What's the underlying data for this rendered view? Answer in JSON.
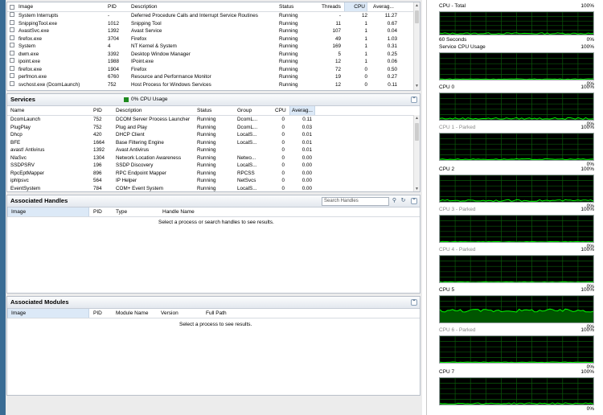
{
  "processes": {
    "columns": [
      "Image",
      "PID",
      "Description",
      "Status",
      "Threads",
      "CPU",
      "Averag..."
    ],
    "rows": [
      [
        "System Interrupts",
        "-",
        "Deferred Procedure Calls and Interrupt Service Routines",
        "Running",
        "-",
        "12",
        "11.27"
      ],
      [
        "SnippingTool.exe",
        "1012",
        "Snipping Tool",
        "Running",
        "11",
        "1",
        "0.67"
      ],
      [
        "AvastSvc.exe",
        "1392",
        "Avast Service",
        "Running",
        "107",
        "1",
        "0.04"
      ],
      [
        "firefox.exe",
        "3704",
        "Firefox",
        "Running",
        "49",
        "1",
        "1.03"
      ],
      [
        "System",
        "4",
        "NT Kernel & System",
        "Running",
        "169",
        "1",
        "0.31"
      ],
      [
        "dwm.exe",
        "3392",
        "Desktop Window Manager",
        "Running",
        "5",
        "1",
        "0.25"
      ],
      [
        "ipoint.exe",
        "1988",
        "IPoint.exe",
        "Running",
        "12",
        "1",
        "0.06"
      ],
      [
        "firefox.exe",
        "1904",
        "Firefox",
        "Running",
        "72",
        "0",
        "0.50"
      ],
      [
        "perfmon.exe",
        "6760",
        "Resource and Performance Monitor",
        "Running",
        "19",
        "0",
        "0.27"
      ],
      [
        "svchost.exe (DcomLaunch)",
        "752",
        "Host Process for Windows Services",
        "Running",
        "12",
        "0",
        "0.11"
      ]
    ]
  },
  "services": {
    "title": "Services",
    "badge": "0% CPU Usage",
    "columns": [
      "Name",
      "PID",
      "Description",
      "Status",
      "Group",
      "CPU",
      "Averag..."
    ],
    "rows": [
      [
        "DcomLaunch",
        "752",
        "DCOM Server Process Launcher",
        "Running",
        "DcomL...",
        "0",
        "0.11"
      ],
      [
        "PlugPlay",
        "752",
        "Plug and Play",
        "Running",
        "DcomL...",
        "0",
        "0.03"
      ],
      [
        "Dhcp",
        "420",
        "DHCP Client",
        "Running",
        "LocalS...",
        "0",
        "0.01"
      ],
      [
        "BFE",
        "1664",
        "Base Filtering Engine",
        "Running",
        "LocalS...",
        "0",
        "0.01"
      ],
      [
        "avast! Antivirus",
        "1392",
        "Avast Antivirus",
        "Running",
        "",
        "0",
        "0.01"
      ],
      [
        "NlaSvc",
        "1304",
        "Network Location Awareness",
        "Running",
        "Netwo...",
        "0",
        "0.00"
      ],
      [
        "SSDPSRV",
        "196",
        "SSDP Discovery",
        "Running",
        "LocalS...",
        "0",
        "0.00"
      ],
      [
        "RpcEptMapper",
        "896",
        "RPC Endpoint Mapper",
        "Running",
        "RPCSS",
        "0",
        "0.00"
      ],
      [
        "iphlpsvc",
        "564",
        "IP Helper",
        "Running",
        "NetSvcs",
        "0",
        "0.00"
      ],
      [
        "EventSystem",
        "784",
        "COM+ Event System",
        "Running",
        "LocalS...",
        "0",
        "0.00"
      ]
    ]
  },
  "handles": {
    "title": "Associated Handles",
    "search_placeholder": "Search Handles",
    "columns": [
      "Image",
      "PID",
      "Type",
      "Handle Name"
    ],
    "empty_message": "Select a process or search handles to see results."
  },
  "modules": {
    "title": "Associated Modules",
    "columns": [
      "Image",
      "PID",
      "Module Name",
      "Version",
      "Full Path"
    ],
    "empty_message": "Select a process to see results."
  },
  "graphs": [
    {
      "title": "CPU - Total",
      "max": "100%",
      "min": "",
      "parked": false,
      "level": 0.05
    },
    {
      "title": "Service CPU Usage",
      "max": "100%",
      "min": "0%",
      "parked": false,
      "level": 0.02
    },
    {
      "title": "CPU 0",
      "max": "100%",
      "min": "0%",
      "parked": false,
      "level": 0.05
    },
    {
      "title": "CPU 1 - Parked",
      "max": "100%",
      "min": "0%",
      "parked": true,
      "level": 0.03
    },
    {
      "title": "CPU 2",
      "max": "100%",
      "min": "0%",
      "parked": false,
      "level": 0.05
    },
    {
      "title": "CPU 3 - Parked",
      "max": "100%",
      "min": "0%",
      "parked": true,
      "level": 0.01
    },
    {
      "title": "CPU 4 - Parked",
      "max": "100%",
      "min": "0%",
      "parked": true,
      "level": 0.01
    },
    {
      "title": "CPU 5",
      "max": "100%",
      "min": "0%",
      "parked": false,
      "level": 0.45
    },
    {
      "title": "CPU 6 - Parked",
      "max": "100%",
      "min": "0%",
      "parked": true,
      "level": 0.02
    },
    {
      "title": "CPU 7",
      "max": "100%",
      "min": "0%",
      "parked": false,
      "level": 0.04
    }
  ],
  "total_axis": {
    "left_label": "60 Seconds",
    "right_label": "0%"
  },
  "colors": {
    "graph_line": "#00ff00",
    "graph_fill": "#005500",
    "graph_grid": "#0a5a0a",
    "graph_bg": "#000000",
    "badge": "#1e8a1e"
  }
}
